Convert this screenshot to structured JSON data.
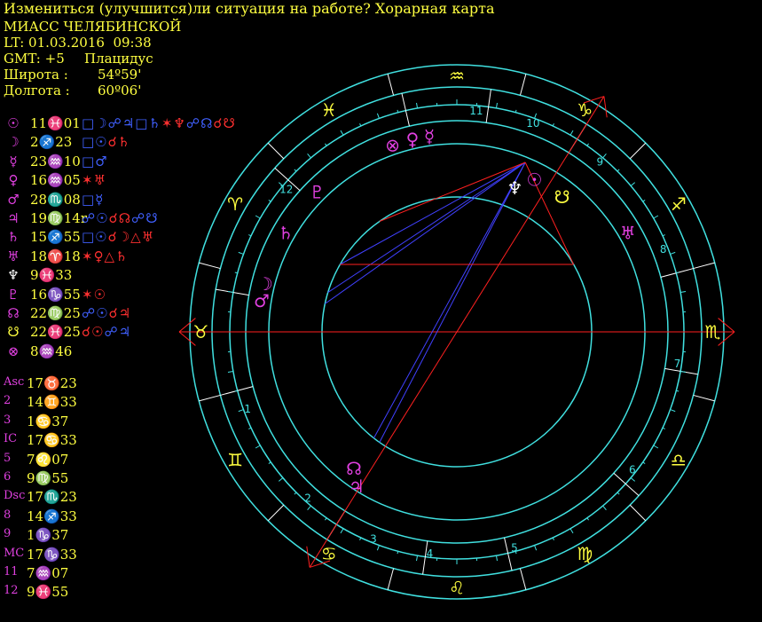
{
  "header": {
    "title": "Измениться (улучшится)ли ситуация на работе? Хорарная карта",
    "place": "МИАСС ЧЕЛЯБИНСКОЙ",
    "lt": "LT: 01.03.2016  09:38",
    "gmt": "GMT: +5",
    "system": "Плацидус",
    "lat_label": "Широта :",
    "lat_value": "54º59'",
    "lon_label": "Долгота :",
    "lon_value": "60º06'"
  },
  "planets": [
    {
      "glyph": "☉",
      "color": "#e040e0",
      "pos": "11♓01",
      "aspects": [
        {
          "t": "□☽",
          "c": "#4060ff"
        },
        {
          "t": "☍♃",
          "c": "#4060ff"
        },
        {
          "t": "□♄",
          "c": "#4060ff"
        },
        {
          "t": "✶♆",
          "c": "#ff3030"
        },
        {
          "t": "☍☊",
          "c": "#4060ff"
        },
        {
          "t": "☌☋",
          "c": "#ff3030"
        }
      ]
    },
    {
      "glyph": "☽",
      "color": "#e040e0",
      "pos": "2♐23",
      "aspects": [
        {
          "t": "□☉",
          "c": "#4060ff"
        },
        {
          "t": "☌♄",
          "c": "#ff3030"
        }
      ]
    },
    {
      "glyph": "☿",
      "color": "#e040e0",
      "pos": "23♒10",
      "aspects": [
        {
          "t": "□♂",
          "c": "#4060ff"
        }
      ]
    },
    {
      "glyph": "♀",
      "color": "#e040e0",
      "pos": "16♒05",
      "aspects": [
        {
          "t": "✶♅",
          "c": "#ff3030"
        }
      ]
    },
    {
      "glyph": "♂",
      "color": "#e040e0",
      "pos": "28♏08",
      "aspects": [
        {
          "t": "□☿",
          "c": "#4060ff"
        }
      ]
    },
    {
      "glyph": "♃",
      "color": "#e040e0",
      "pos": "19♍14r",
      "aspects": [
        {
          "t": "☍☉",
          "c": "#4060ff"
        },
        {
          "t": "☌☊",
          "c": "#ff3030"
        },
        {
          "t": "☍☋",
          "c": "#4060ff"
        }
      ]
    },
    {
      "glyph": "♄",
      "color": "#e040e0",
      "pos": "15♐55",
      "aspects": [
        {
          "t": "□☉",
          "c": "#4060ff"
        },
        {
          "t": "☌☽",
          "c": "#ff3030"
        },
        {
          "t": "△♅",
          "c": "#ff3030"
        }
      ]
    },
    {
      "glyph": "♅",
      "color": "#e040e0",
      "pos": "18♈18",
      "aspects": [
        {
          "t": "✶♀",
          "c": "#ff3030"
        },
        {
          "t": "△♄",
          "c": "#ff3030"
        }
      ]
    },
    {
      "glyph": "♆",
      "color": "#ffffff",
      "pos": "9♓33",
      "aspects": []
    },
    {
      "glyph": "♇",
      "color": "#e040e0",
      "pos": "16♑55",
      "aspects": [
        {
          "t": "✶☉",
          "c": "#ff3030"
        }
      ]
    },
    {
      "glyph": "☊",
      "color": "#e040e0",
      "pos": "22♍25",
      "aspects": [
        {
          "t": "☍☉",
          "c": "#4060ff"
        },
        {
          "t": "☌♃",
          "c": "#ff3030"
        }
      ]
    },
    {
      "glyph": "☋",
      "color": "#ffff40",
      "pos": "22♓25",
      "aspects": [
        {
          "t": "☌☉",
          "c": "#ff3030"
        },
        {
          "t": "☍♃",
          "c": "#4060ff"
        }
      ]
    },
    {
      "glyph": "⊗",
      "color": "#e040e0",
      "pos": "8♒46",
      "aspects": []
    }
  ],
  "houses": [
    {
      "label": "Asc",
      "value": "17♉23"
    },
    {
      "label": "2",
      "value": "14♊33"
    },
    {
      "label": "3",
      "value": "1♋37"
    },
    {
      "label": "IC",
      "value": "17♋33"
    },
    {
      "label": "5",
      "value": "7♌07"
    },
    {
      "label": "6",
      "value": "9♍55"
    },
    {
      "label": "Dsc",
      "value": "17♏23"
    },
    {
      "label": "8",
      "value": "14♐33"
    },
    {
      "label": "9",
      "value": "1♑37"
    },
    {
      "label": "MC",
      "value": "17♑33"
    },
    {
      "label": "11",
      "value": "7♒07"
    },
    {
      "label": "12",
      "value": "9♓55"
    }
  ],
  "wheel": {
    "signs": [
      {
        "glyph": "♉",
        "angle": 0
      },
      {
        "glyph": "♈",
        "angle": 30
      },
      {
        "glyph": "♓",
        "angle": 60
      },
      {
        "glyph": "♒",
        "angle": 90
      },
      {
        "glyph": "♑",
        "angle": 120
      },
      {
        "glyph": "♐",
        "angle": 150
      },
      {
        "glyph": "♏",
        "angle": 180
      },
      {
        "glyph": "♎",
        "angle": 210
      },
      {
        "glyph": "♍",
        "angle": 240
      },
      {
        "glyph": "♌",
        "angle": 270
      },
      {
        "glyph": "♋",
        "angle": 300
      },
      {
        "glyph": "♊",
        "angle": 330
      }
    ],
    "house_numbers": [
      {
        "n": "1",
        "angle": 340
      },
      {
        "n": "2",
        "angle": 312
      },
      {
        "n": "3",
        "angle": 292
      },
      {
        "n": "4",
        "angle": 277
      },
      {
        "n": "5",
        "angle": 255
      },
      {
        "n": "6",
        "angle": 218
      },
      {
        "n": "7",
        "angle": 188
      },
      {
        "n": "8",
        "angle": 158
      },
      {
        "n": "9",
        "angle": 130
      },
      {
        "n": "10",
        "angle": 110
      },
      {
        "n": "11",
        "angle": 95
      },
      {
        "n": "12",
        "angle": 40
      }
    ],
    "planets": [
      {
        "glyph": "☉",
        "angle": 117,
        "r": 0.64,
        "color": "#e040e0"
      },
      {
        "glyph": "♆",
        "angle": 112,
        "r": 0.58,
        "color": "#ffffff"
      },
      {
        "glyph": "☋",
        "angle": 128,
        "r": 0.64,
        "color": "#ffff40"
      },
      {
        "glyph": "☿",
        "angle": 82,
        "r": 0.74,
        "color": "#e040e0"
      },
      {
        "glyph": "♀",
        "angle": 77,
        "r": 0.74,
        "color": "#e040e0"
      },
      {
        "glyph": "⊗",
        "angle": 71,
        "r": 0.74,
        "color": "#e040e0"
      },
      {
        "glyph": "♇",
        "angle": 45,
        "r": 0.74,
        "color": "#e040e0"
      },
      {
        "glyph": "♄",
        "angle": 30,
        "r": 0.74,
        "color": "#e040e0"
      },
      {
        "glyph": "☽",
        "angle": 14,
        "r": 0.74,
        "color": "#e040e0"
      },
      {
        "glyph": "♂",
        "angle": 9,
        "r": 0.74,
        "color": "#e040e0"
      },
      {
        "glyph": "♅",
        "angle": 150,
        "r": 0.74,
        "color": "#e040e0"
      },
      {
        "glyph": "☊",
        "angle": -53,
        "r": 0.64,
        "color": "#e040e0"
      },
      {
        "glyph": "♃",
        "angle": -57,
        "r": 0.69,
        "color": "#e040e0"
      }
    ],
    "colors": {
      "ring": "#40e0e0",
      "axis": "#ff2020",
      "aspect_blue": "#4040ff",
      "aspect_red": "#ff2020",
      "sign": "#ffff40"
    }
  }
}
